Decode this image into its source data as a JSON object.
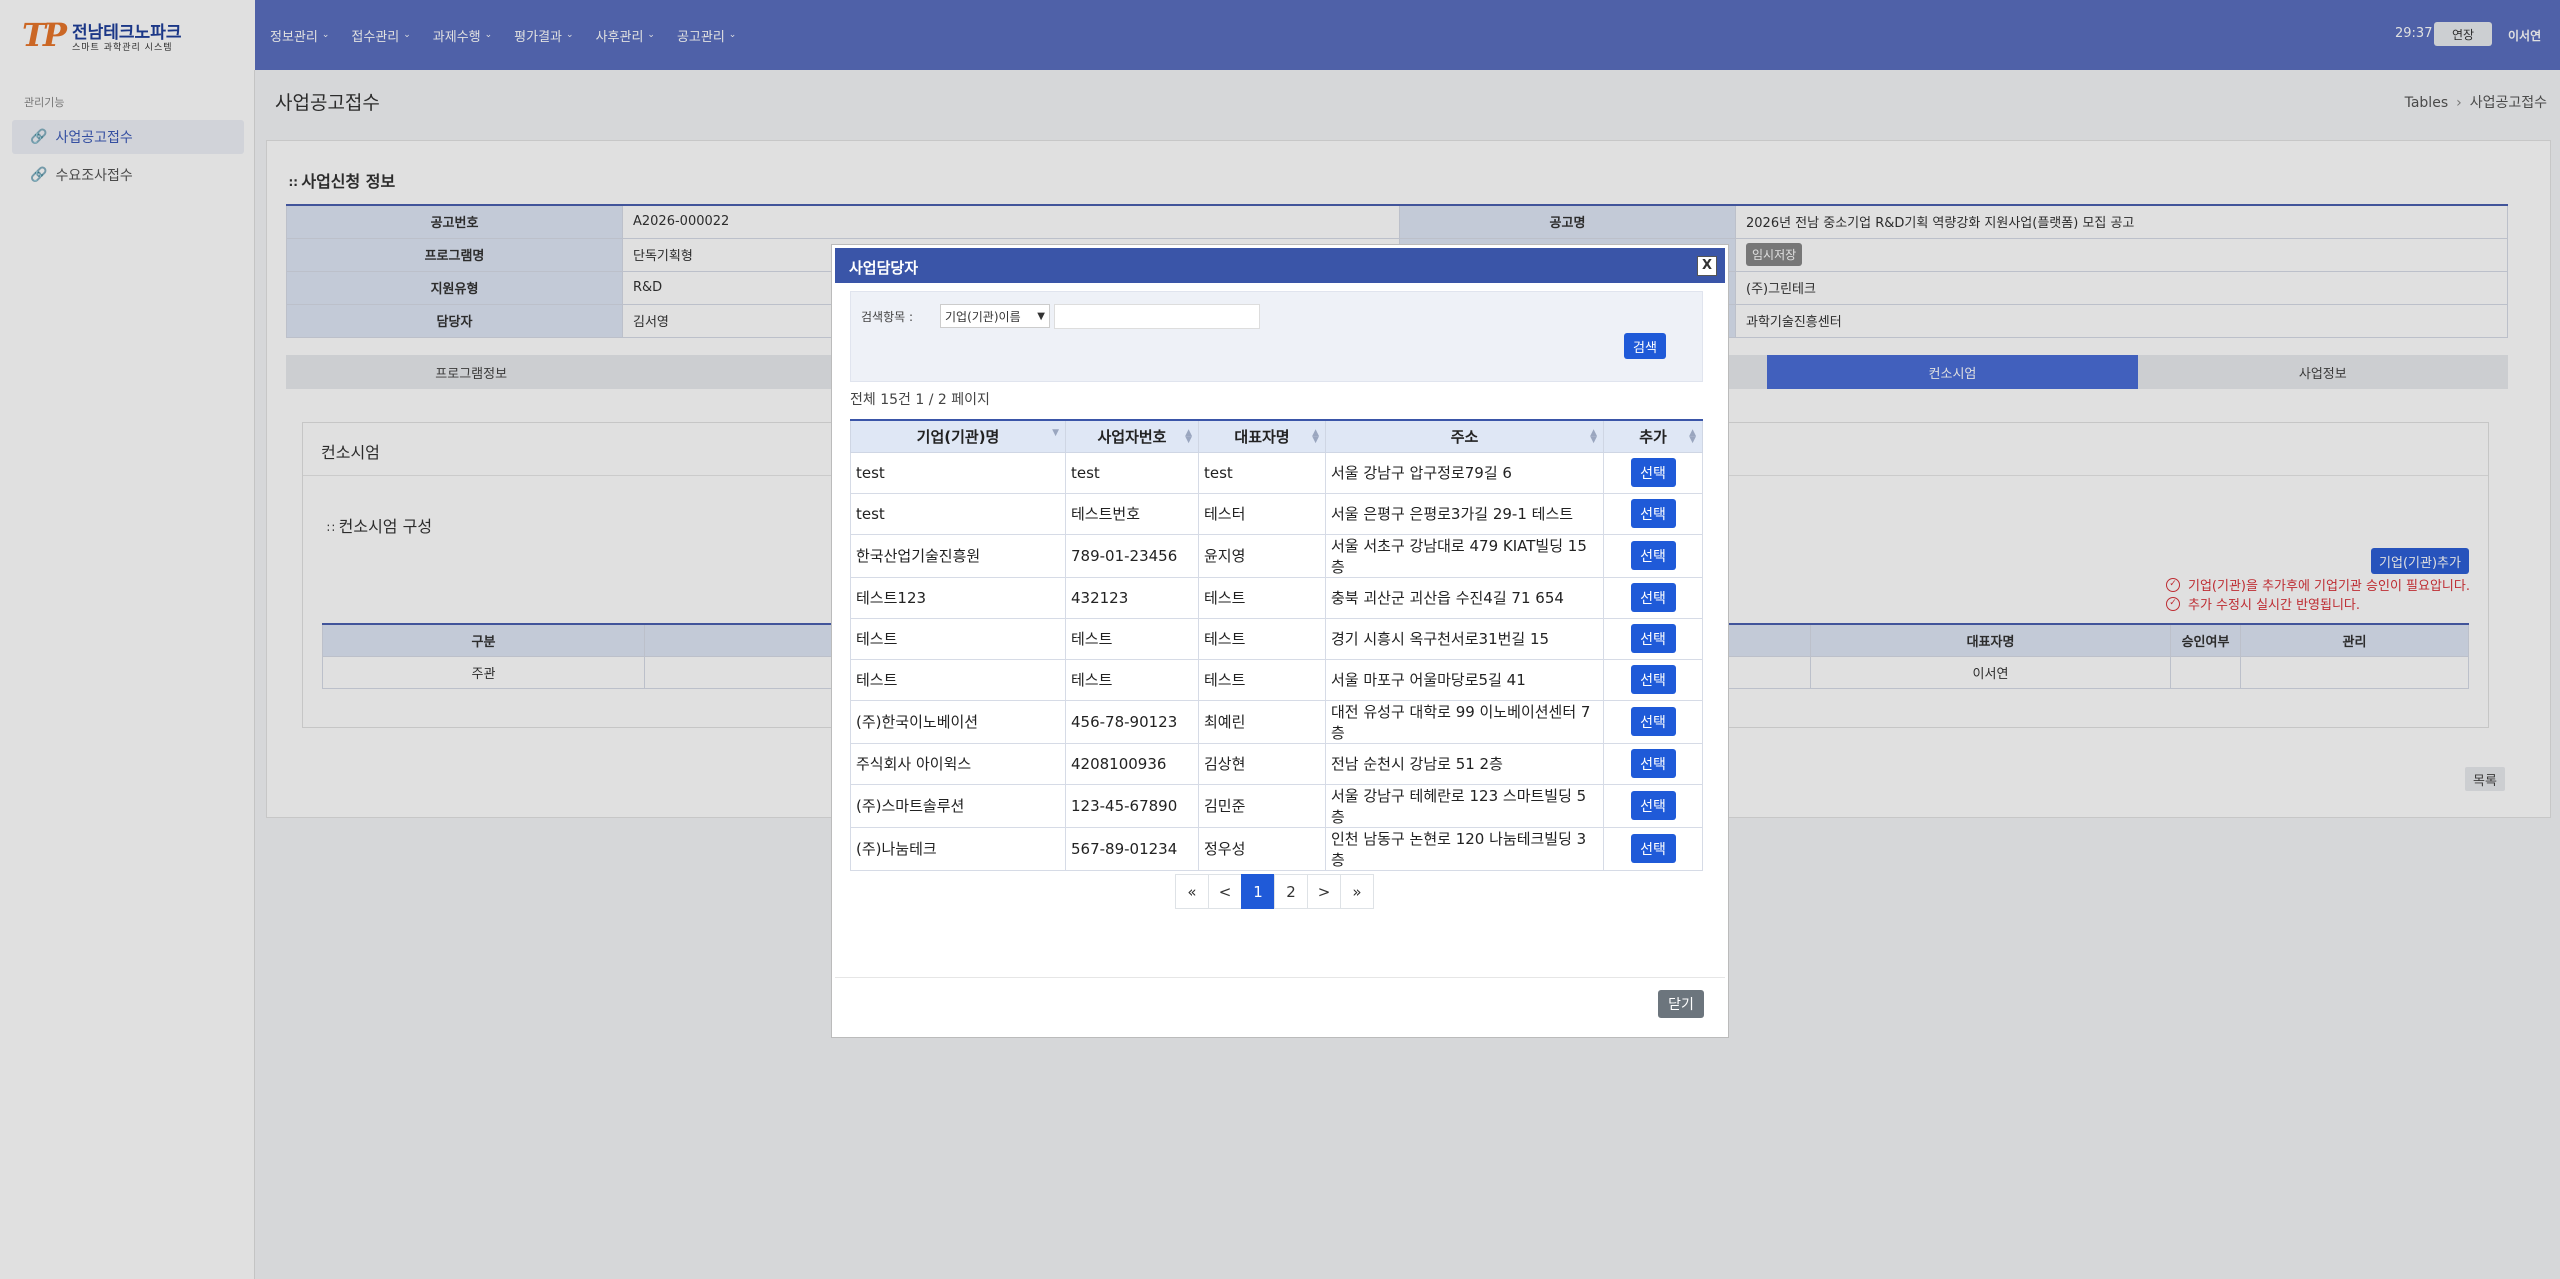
{
  "header": {
    "logo_mark": "TP",
    "logo_title": "전남테크노파크",
    "logo_subtitle": "스마트 과학관리 시스템",
    "nav": [
      "정보관리",
      "접수관리",
      "과제수행",
      "평가결과",
      "사후관리",
      "공고관리"
    ],
    "timer": "29:37",
    "extend_label": "연장",
    "username": "이서연"
  },
  "sidebar": {
    "heading": "관리기능",
    "items": [
      {
        "label": "사업공고접수",
        "active": true
      },
      {
        "label": "수요조사접수",
        "active": false
      }
    ]
  },
  "page": {
    "title": "사업공고접수",
    "breadcrumb": [
      "Tables",
      "사업공고접수"
    ]
  },
  "info": {
    "section_title": "사업신청 정보",
    "rows": [
      {
        "label1": "공고번호",
        "value1": "A2026-000022",
        "label2": "공고명",
        "value2": "2026년 전남 중소기업 R&D기획 역량강화 지원사업(플랫폼) 모집 공고"
      },
      {
        "label1": "프로그램명",
        "value1": "단독기획형",
        "label2": "",
        "value2": ""
      },
      {
        "label1": "지원유형",
        "value1": "R&D",
        "label2": "",
        "value2": "(주)그린테크"
      },
      {
        "label1": "담당자",
        "value1": "김서영",
        "label2": "",
        "value2": "과학기술진흥센터"
      }
    ],
    "temp_save_label": "임시저장"
  },
  "tabs": [
    "프로그램정보",
    "",
    "",
    "",
    "컨소시엄",
    "사업정보"
  ],
  "consortium": {
    "title": "컨소시엄",
    "section_title": "컨소시엄 구성",
    "add_button": "기업(기관)추가",
    "notices": [
      "기업(기관)을 추가후에 기업기관 승인이 필요압니다.",
      "추가 수정시 실시간 반영됩니다."
    ],
    "columns": [
      "구분",
      "",
      "",
      "대표자명",
      "승인여부",
      "관리"
    ],
    "rows": [
      {
        "type": "주관",
        "rep": "이서연",
        "approved": "",
        "manage": ""
      }
    ],
    "list_button": "목록"
  },
  "modal": {
    "title": "사업담당자",
    "close_x": "X",
    "search_label": "검색항목 :",
    "search_option": "기업(기관)이름",
    "search_value": "",
    "search_button": "검색",
    "summary": "전체 15건 1 / 2 페이지",
    "columns": [
      "기업(기관)명",
      "사업자번호",
      "대표자명",
      "주소",
      "추가"
    ],
    "rows": [
      {
        "name": "test",
        "biz_no": "test",
        "rep": "test",
        "address": "서울 강남구 압구정로79길 6",
        "action": "선택"
      },
      {
        "name": "test",
        "biz_no": "테스트번호",
        "rep": "테스터",
        "address": "서울 은평구 은평로3가길 29-1 테스트",
        "action": "선택"
      },
      {
        "name": "한국산업기술진흥원",
        "biz_no": "789-01-23456",
        "rep": "윤지영",
        "address": "서울 서초구 강남대로 479 KIAT빌딩 15층",
        "action": "선택"
      },
      {
        "name": "테스트123",
        "biz_no": "432123",
        "rep": "테스트",
        "address": "충북 괴산군 괴산읍 수진4길 71 654",
        "action": "선택"
      },
      {
        "name": "테스트",
        "biz_no": "테스트",
        "rep": "테스트",
        "address": "경기 시흥시 옥구천서로31번길 15",
        "action": "선택"
      },
      {
        "name": "테스트",
        "biz_no": "테스트",
        "rep": "테스트",
        "address": "서울 마포구 어울마당로5길 41",
        "action": "선택"
      },
      {
        "name": "(주)한국이노베이션",
        "biz_no": "456-78-90123",
        "rep": "최예린",
        "address": "대전 유성구 대학로 99 이노베이션센터 7층",
        "action": "선택"
      },
      {
        "name": "주식회사 아이윅스",
        "biz_no": "4208100936",
        "rep": "김상현",
        "address": "전남 순천시 강남로 51 2층",
        "action": "선택"
      },
      {
        "name": "(주)스마트솔루션",
        "biz_no": "123-45-67890",
        "rep": "김민준",
        "address": "서울 강남구 테헤란로 123 스마트빌딩 5층",
        "action": "선택"
      },
      {
        "name": "(주)나눔테크",
        "biz_no": "567-89-01234",
        "rep": "정우성",
        "address": "인천 남동구 논현로 120 나눔테크빌딩 3층",
        "action": "선택"
      }
    ],
    "pagination": [
      "«",
      "<",
      "1",
      "2",
      ">",
      "»"
    ],
    "current_page": "1",
    "close_button": "닫기"
  },
  "colors": {
    "header_bg": "#5a6fc0",
    "modal_header": "#3a55a8",
    "primary_button": "#1f5ad8",
    "active_tab": "#4a6ed8",
    "notice_red": "#d9333a"
  }
}
